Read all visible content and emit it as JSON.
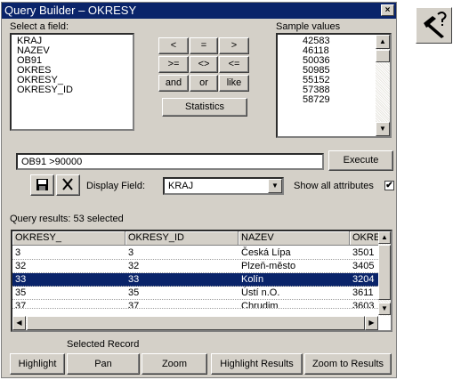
{
  "window": {
    "title": "Query Builder – OKRESY",
    "close_label": "×"
  },
  "fields": {
    "label": "Select a field:",
    "items": [
      "KRAJ",
      "NAZEV",
      "OB91",
      "OKRES",
      "OKRESY_",
      "OKRESY_ID"
    ]
  },
  "operators": {
    "rows": [
      [
        "<",
        "=",
        ">"
      ],
      [
        ">=",
        "<>",
        "<="
      ],
      [
        "and",
        "or",
        "like"
      ]
    ],
    "statistics_label": "Statistics"
  },
  "samples": {
    "label": "Sample values",
    "items": [
      "42583",
      "46118",
      "50036",
      "50985",
      "55152",
      "57388",
      "58729"
    ]
  },
  "query": {
    "expression": "OB91 >90000",
    "execute_label": "Execute",
    "display_field_label": "Display Field:",
    "display_field_value": "KRAJ",
    "show_all_label": "Show all attributes",
    "show_all_checked": "✔"
  },
  "results": {
    "summary": "Query results: 53 selected",
    "columns": [
      "OKRESY_",
      "OKRESY_ID",
      "NAZEV",
      "OKRE"
    ],
    "rows": [
      {
        "cells": [
          "3",
          "3",
          "Česká Lípa",
          "3501"
        ],
        "selected": false
      },
      {
        "cells": [
          "32",
          "32",
          "Plzeň-město",
          "3405"
        ],
        "selected": false
      },
      {
        "cells": [
          "33",
          "33",
          "Kolín",
          "3204"
        ],
        "selected": true
      },
      {
        "cells": [
          "35",
          "35",
          "Ústí n.O.",
          "3611"
        ],
        "selected": false
      },
      {
        "cells": [
          "37",
          "37",
          "Chrudim",
          "3603"
        ],
        "selected": false
      }
    ]
  },
  "selected_record": {
    "label": "Selected Record",
    "buttons": [
      "Highlight",
      "Pan",
      "Zoom",
      "Highlight Results",
      "Zoom to Results"
    ]
  },
  "icons": {
    "save": "save-icon",
    "clear": "close-icon",
    "tool": "query-tool-icon"
  },
  "colors": {
    "title_bar": "#0a246a",
    "selection": "#0a246a",
    "face": "#d4d0c8"
  }
}
